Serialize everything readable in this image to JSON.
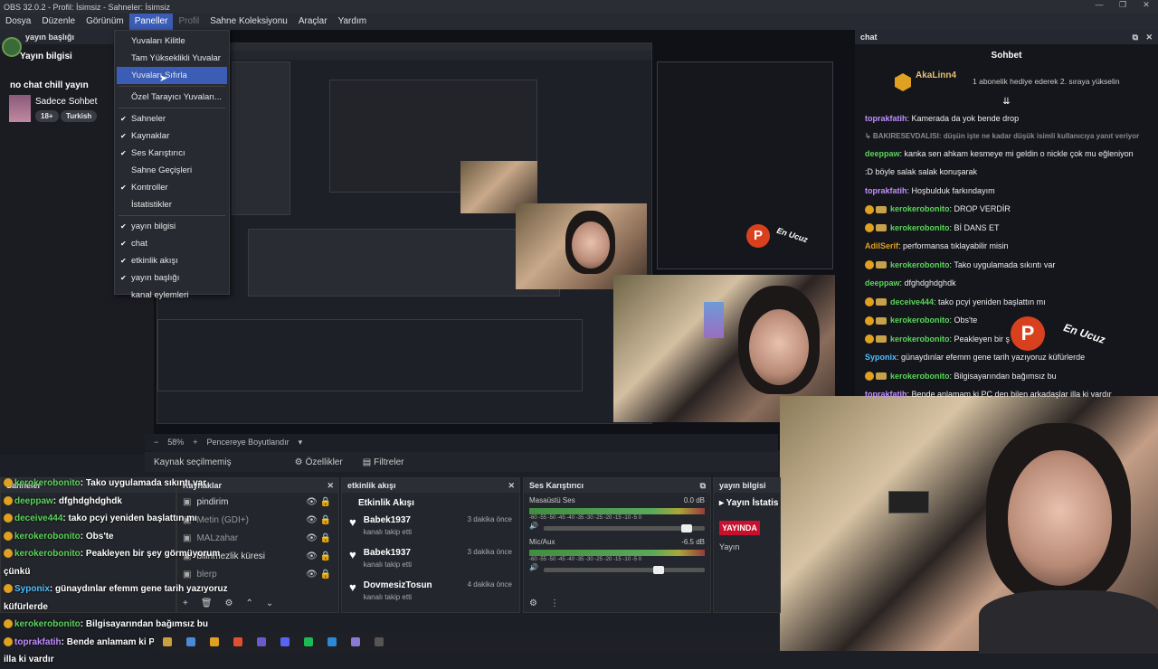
{
  "window": {
    "title": "OBS 32.0.2 - Profil: İsimsiz - Sahneler: İsimsiz",
    "controls": [
      "—",
      "❐",
      "✕"
    ]
  },
  "menu": [
    {
      "label": "Dosya",
      "active": false,
      "disabled": false
    },
    {
      "label": "Düzenle",
      "active": false,
      "disabled": false
    },
    {
      "label": "Görünüm",
      "active": false,
      "disabled": false
    },
    {
      "label": "Paneller",
      "active": true,
      "disabled": false
    },
    {
      "label": "Profil",
      "active": false,
      "disabled": true
    },
    {
      "label": "Sahne Koleksiyonu",
      "active": false,
      "disabled": false
    },
    {
      "label": "Araçlar",
      "active": false,
      "disabled": false
    },
    {
      "label": "Yardım",
      "active": false,
      "disabled": false
    }
  ],
  "dropdown": {
    "group1": [
      "Yuvaları Kilitle",
      "Tam Yükseklikli Yuvalar",
      "Yuvaları Sıfırla",
      "Özel Tarayıcı Yuvaları..."
    ],
    "highlighted_index": 2,
    "group2": [
      {
        "label": "Sahneler",
        "checked": true
      },
      {
        "label": "Kaynaklar",
        "checked": true
      },
      {
        "label": "Ses Karıştırıcı",
        "checked": true
      },
      {
        "label": "Sahne Geçişleri",
        "checked": false
      },
      {
        "label": "Kontroller",
        "checked": true
      },
      {
        "label": "İstatistikler",
        "checked": false
      }
    ],
    "group3": [
      {
        "label": "yayın bilgisi",
        "checked": true
      },
      {
        "label": "chat",
        "checked": true
      },
      {
        "label": "etkinlik akışı",
        "checked": true
      },
      {
        "label": "yayın başlığı",
        "checked": true
      },
      {
        "label": "kanal eylemleri",
        "checked": false
      }
    ]
  },
  "left_dock": {
    "header": "yayın başlığı",
    "info_title": "Yayın bilgisi",
    "stream_title": "no chat chill yayın",
    "category": "Sadece Sohbet",
    "tags": [
      "18+",
      "Turkish"
    ]
  },
  "preview_bar": {
    "zoom": "58%",
    "fit": "Pencereye Boyutlandır"
  },
  "source_bar": {
    "label": "Kaynak seçilmemiş",
    "properties": "Özellikler",
    "filters": "Filtreler"
  },
  "scenes_dock": {
    "title": "Sahneler"
  },
  "sources_dock": {
    "title": "Kaynaklar",
    "items": [
      "pindirim",
      "Metin (GDI+)",
      "MALzahar",
      "bilinmezlik küresi",
      "blerp"
    ]
  },
  "events_dock": {
    "title": "etkinlik akışı",
    "heading": "Etkinlik Akışı",
    "items": [
      {
        "name": "Babek1937",
        "sub": "kanalı takip etti",
        "time": "3 dakika önce"
      },
      {
        "name": "Babek1937",
        "sub": "kanalı takip etti",
        "time": "3 dakika önce"
      },
      {
        "name": "DovmesizTosun",
        "sub": "kanalı takip etti",
        "time": "4 dakika önce"
      }
    ]
  },
  "mixer_dock": {
    "title": "Ses Karıştırıcı",
    "channels": [
      {
        "name": "Masaüstü Ses",
        "db": "0.0 dB",
        "volume": 0.92
      },
      {
        "name": "Mic/Aux",
        "db": "-6.5 dB",
        "volume": 0.75
      }
    ],
    "scale": "-60 -55 -50 -45 -40 -35 -30 -25 -20 -15 -10 -5 0"
  },
  "info_dock": {
    "title": "yayın bilgisi",
    "heading": "Yayın İstatis",
    "live": "YAYINDA",
    "label": "Yayın"
  },
  "chat_dock": {
    "header": "chat",
    "title": "Sohbet",
    "pinned_user": "AkaLinn4",
    "pinned_text": "1 abonelik hediye ederek 2. sıraya yükselin",
    "messages": [
      {
        "user": "toprakfatih",
        "color": "#c08fff",
        "text": ": Kamerada da yok bende drop",
        "badges": false
      },
      {
        "user": "↳ BAKIRESEVDALISI: düşün işte ne kadar düşük isimli kullanıcıya yanıt veriyor",
        "color": "#8a8a8a",
        "text": "",
        "badges": false,
        "reply": true
      },
      {
        "user": "deeppaw",
        "color": "#5ad45a",
        "text": ": kanka sen ahkam kesmeye mi geldin o nickle çok mu eğleniyon",
        "badges": false
      },
      {
        "user": "",
        "color": "#eee",
        "text": ":D böyle salak salak konuşarak",
        "badges": false
      },
      {
        "user": "toprakfatih",
        "color": "#c08fff",
        "text": ": Hoşbulduk farkındayım",
        "badges": false
      },
      {
        "user": "kerokerobonito",
        "color": "#5ad45a",
        "text": ": DROP VERDİR",
        "badges": true
      },
      {
        "user": "kerokerobonito",
        "color": "#5ad45a",
        "text": ": Bİ DANS ET",
        "badges": true
      },
      {
        "user": "AdilSerif",
        "color": "#e0a020",
        "text": ": performansa tıklayabilir misin",
        "badges": false
      },
      {
        "user": "kerokerobonito",
        "color": "#5ad45a",
        "text": ": Tako uygulamada sıkıntı var",
        "badges": true
      },
      {
        "user": "deeppaw",
        "color": "#5ad45a",
        "text": ": dfghdghdghdk",
        "badges": false
      },
      {
        "user": "deceive444",
        "color": "#5ad45a",
        "text": ": tako pcyi yeniden başlattın mı",
        "badges": true
      },
      {
        "user": "kerokerobonito",
        "color": "#5ad45a",
        "text": ": Obs'te",
        "badges": true
      },
      {
        "user": "kerokerobonito",
        "color": "#5ad45a",
        "text": ": Peakleyen bir ş",
        "badges": true
      },
      {
        "user": "Syponix",
        "color": "#4fc0ff",
        "text": ": günaydınlar efemm gene tarih yazıyoruz küfürlerde",
        "badges": false
      },
      {
        "user": "kerokerobonito",
        "color": "#5ad45a",
        "text": ": Bilgisayarından bağımsız bu",
        "badges": true
      },
      {
        "user": "toprakfatih",
        "color": "#c08fff",
        "text": ": Bende anlamam ki PC den bilen arkadaşlar illa ki vardır",
        "badges": false
      }
    ]
  },
  "overlay_chat": [
    {
      "user": "kerokerobonito",
      "color": "#5ad45a",
      "text": ": Tako uygulamada sıkıntı var"
    },
    {
      "user": "deeppaw",
      "color": "#5ad45a",
      "text": ": dfghdghdghdk"
    },
    {
      "user": "deceive444",
      "color": "#5ad45a",
      "text": ": tako pcyi yeniden başlattın mı"
    },
    {
      "user": "kerokerobonito",
      "color": "#5ad45a",
      "text": ": Obs'te"
    },
    {
      "user": "kerokerobonito",
      "color": "#5ad45a",
      "text": ": Peakleyen bir şey görmüyorum"
    },
    {
      "user": "",
      "color": "#fff",
      "text": "çünkü"
    },
    {
      "user": "Syponix",
      "color": "#4fc0ff",
      "text": ": günaydınlar efemm gene tarih yazıyoruz"
    },
    {
      "user": "",
      "color": "#fff",
      "text": "küfürlerde"
    },
    {
      "user": "kerokerobonito",
      "color": "#5ad45a",
      "text": ": Bilgisayarından bağımsız bu"
    },
    {
      "user": "toprakfatih",
      "color": "#c08fff",
      "text": ": Bende anlamam ki PC den bilen arkadaşlar"
    },
    {
      "user": "",
      "color": "#fff",
      "text": "illa ki vardır"
    }
  ],
  "watermark": {
    "letter": "P",
    "text": "En Ucuz"
  }
}
